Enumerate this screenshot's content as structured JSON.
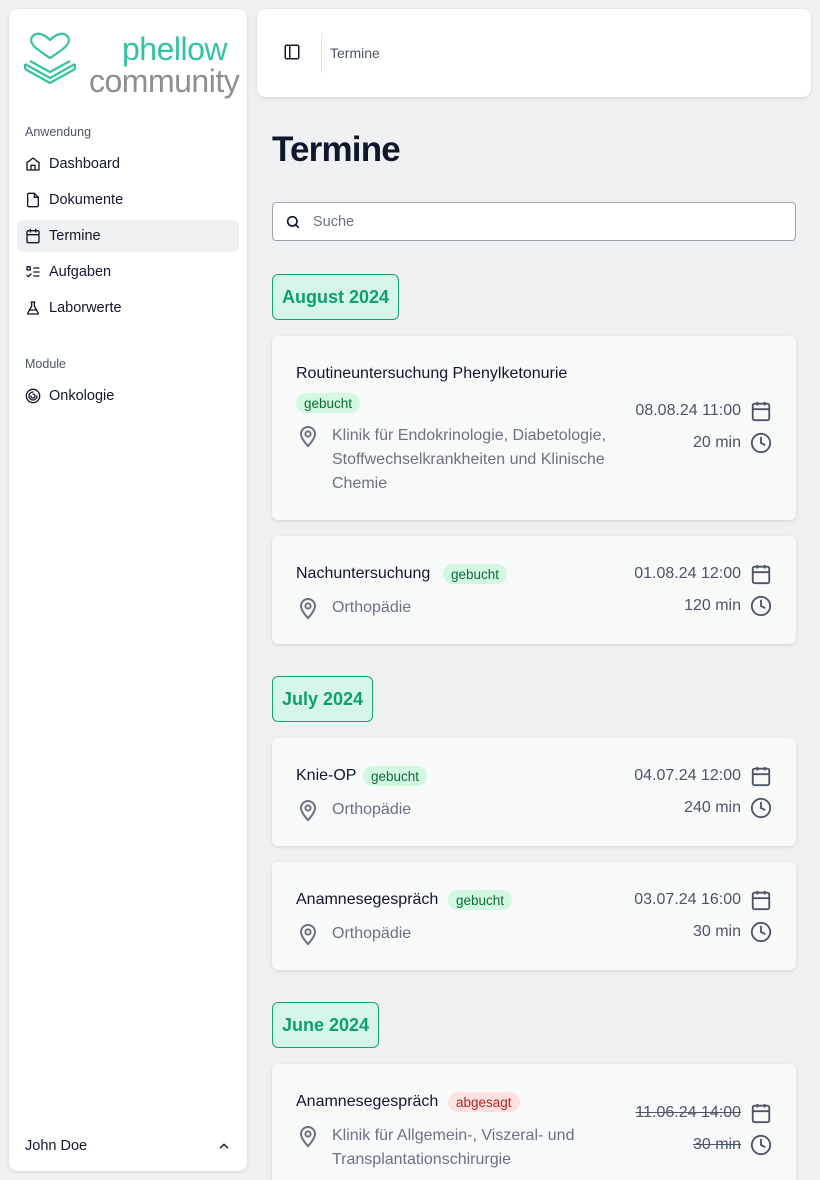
{
  "brand": {
    "line1": "phellow",
    "line2": "community",
    "color": "#34c3a0"
  },
  "sidebar": {
    "group1_label": "Anwendung",
    "items": [
      {
        "label": "Dashboard",
        "icon": "home-icon"
      },
      {
        "label": "Dokumente",
        "icon": "file-icon"
      },
      {
        "label": "Termine",
        "icon": "calendar-icon",
        "active": true
      },
      {
        "label": "Aufgaben",
        "icon": "checklist-icon"
      },
      {
        "label": "Laborwerte",
        "icon": "flask-icon"
      }
    ],
    "group2_label": "Module",
    "module_items": [
      {
        "label": "Onkologie",
        "icon": "spiral-icon"
      }
    ],
    "user": {
      "name": "John Doe"
    }
  },
  "header": {
    "breadcrumb": "Termine"
  },
  "page": {
    "title": "Termine"
  },
  "search": {
    "placeholder": "Suche",
    "value": ""
  },
  "groups": [
    {
      "month": "August 2024",
      "appointments": [
        {
          "title": "Routineuntersuchung Phenylketonurie",
          "status": "gebucht",
          "location": "Klinik für Endokrinologie, Diabetologie, Stoffwechselkrankheiten und Klinische Chemie",
          "datetime": "08.08.24 11:00",
          "duration": "20 min"
        },
        {
          "title": "Nachuntersuchung",
          "status": "gebucht",
          "location": "Orthopädie",
          "datetime": "01.08.24 12:00",
          "duration": "120 min"
        }
      ]
    },
    {
      "month": "July 2024",
      "appointments": [
        {
          "title": "Knie-OP",
          "status": "gebucht",
          "location": "Orthopädie",
          "datetime": "04.07.24 12:00",
          "duration": "240 min"
        },
        {
          "title": "Anamnesegespräch",
          "status": "gebucht",
          "location": "Orthopädie",
          "datetime": "03.07.24 16:00",
          "duration": "30 min"
        }
      ]
    },
    {
      "month": "June 2024",
      "appointments": [
        {
          "title": "Anamnesegespräch",
          "status": "abgesagt",
          "location": "Klinik für Allgemein-, Viszeral- und Transplantationschirurgie",
          "datetime": "11.06.24 14:00",
          "duration": "30 min"
        }
      ]
    }
  ]
}
